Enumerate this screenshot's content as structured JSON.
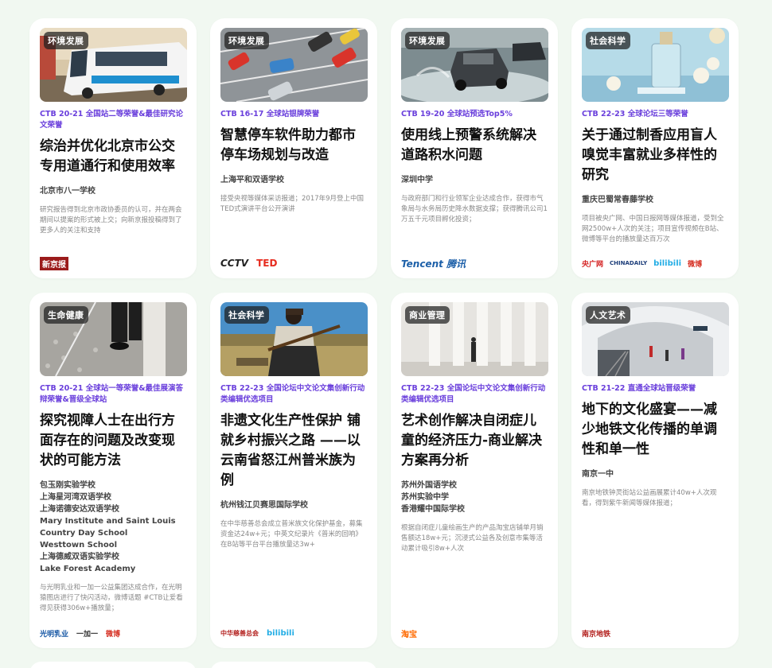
{
  "cards": [
    {
      "tag": "环境发展",
      "award": "CTB 20-21 全国站二等荣誉&最佳研究论文荣誉",
      "title": "综治并优化北京市公交专用道通行和使用效率",
      "schools": [
        "北京市八一学校"
      ],
      "desc": "研究报告得到北京市政协委员的认可，并在两会期间以提案的形式被上交；向新京报投稿得到了更多人的关注和支持",
      "logos": [
        "新京报"
      ]
    },
    {
      "tag": "环境发展",
      "award": "CTB 16-17 全球站银牌荣誉",
      "title": "智慧停车软件助力都市停车场规划与改造",
      "schools": [
        "上海平和双语学校"
      ],
      "desc": "接受央视等媒体采访报道；2017年9月登上中国TED式演讲平台公开演讲",
      "logos": [
        "CCTV",
        "TED"
      ]
    },
    {
      "tag": "环境发展",
      "award": "CTB 19-20 全球站预选Top5%",
      "title": "使用线上预警系统解决道路积水问题",
      "schools": [
        "深圳中学"
      ],
      "desc": "与政府部门和行业领军企业达成合作，获得市气象局与水务局历史降水数据支撑；获得腾讯公司1万五千元项目孵化投资；",
      "logos": [
        "Tencent 腾讯"
      ]
    },
    {
      "tag": "社会科学",
      "award": "CTB 22-23 全球论坛三等荣誉",
      "title": "关于通过制香应用盲人嗅觉丰富就业多样性的研究",
      "schools": [
        "重庆巴蜀常春藤学校"
      ],
      "desc": "项目被央广网、中国日报网等媒体报道，受到全网2500w+人次的关注；项目宣传视频在B站、微博等平台的播放量达百万次",
      "logos": [
        "央广网",
        "CHINADAILY",
        "bilibili",
        "微博"
      ]
    },
    {
      "tag": "生命健康",
      "award": "CTB 20-21 全球站一等荣誉&最佳展演答辩荣誉&晋级全球站",
      "title": "探究视障人士在出行方面存在的问题及改变现状的可能方法",
      "schools": [
        "包玉刚实验学校",
        "上海星河湾双语学校",
        "上海诺德安达双语学校",
        "Mary Institute and Saint Louis Country Day School",
        "Westtown School",
        "上海德威双语实验学校",
        "Lake Forest Academy"
      ],
      "desc": "与光明乳业和一加一公益集团达成合作，在光明猿图店进行了快闪活动，微博话题 #CTB让爱看得见获得306w+播放量；",
      "logos": [
        "光明乳业",
        "一加一",
        "微博"
      ]
    },
    {
      "tag": "社会科学",
      "award": "CTB 22-23 全国论坛中文论文集创新行动类编辑优选项目",
      "title": "非遗文化生产性保护 铺就乡村振兴之路 ——以云南省怒江州普米族为例",
      "schools": [
        "杭州钱江贝赛思国际学校"
      ],
      "desc": "在中华慈善总会成立普米族文化保护基金，募集资金达24w+元；中英文纪录片《普米的回响》在B站等平台平台播放量达3w+",
      "logos": [
        "中华慈善总会",
        "bilibili"
      ]
    },
    {
      "tag": "商业管理",
      "award": "CTB 22-23 全国论坛中文论文集创新行动类编辑优选项目",
      "title": "艺术创作解决自闭症儿童的经济压力-商业解决方案再分析",
      "schools": [
        "苏州外国语学校",
        "苏州实验中学",
        "香港耀中国际学校"
      ],
      "desc": "根据自闭症儿童绘画生产的产品淘宝店铺单月销售额达18w+元；沉浸式公益各及创意市集等活动累计吸引8w+人次",
      "logos": [
        "淘宝"
      ]
    },
    {
      "tag": "人文艺术",
      "award": "CTB 21-22 直通全球站晋级荣誉",
      "title": "地下的文化盛宴——减少地铁文化传播的单调性和单一性",
      "schools": [
        "南京一中"
      ],
      "desc": "南京地铁钟灵街站公益画展累计40w+人次观看，得到紫牛新闻等媒体报道；",
      "logos": [
        "南京地铁"
      ]
    }
  ],
  "colors": {
    "background": "#f1f8f1",
    "award": "#6a3fdc"
  }
}
